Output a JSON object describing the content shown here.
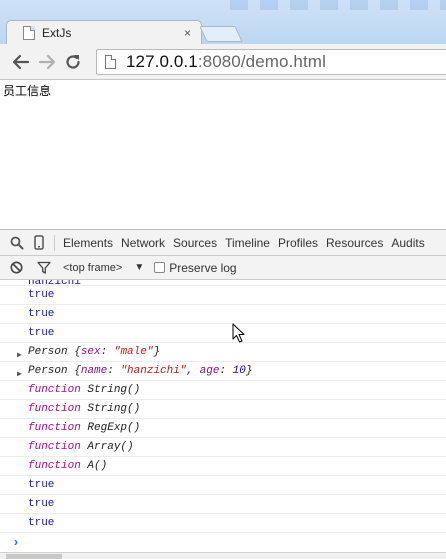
{
  "browser": {
    "tab_title": "ExtJs",
    "tab_close_glyph": "×",
    "url_host": "127.0.0.1",
    "url_rest": ":8080/demo.html"
  },
  "page": {
    "heading": "员工信息"
  },
  "devtools": {
    "tabs": [
      "Elements",
      "Network",
      "Sources",
      "Timeline",
      "Profiles",
      "Resources",
      "Audits"
    ],
    "frame_select": "<top frame>",
    "frame_arrow": "▼",
    "preserve_log": "Preserve log",
    "preserve_log_checked": false,
    "console": {
      "partial_line": "hanzichi",
      "bool_lines_1": [
        "true",
        "true",
        "true"
      ],
      "objects": [
        {
          "class_name": "Person",
          "open": "{",
          "props": [
            {
              "key": "sex",
              "sep": ": ",
              "value": "\"male\"",
              "kind": "str"
            }
          ],
          "close": "}"
        },
        {
          "class_name": "Person",
          "open": "{",
          "props": [
            {
              "key": "name",
              "sep": ": ",
              "value": "\"hanzichi\"",
              "kind": "str"
            },
            {
              "key": "age",
              "sep": ": ",
              "value": "10",
              "kind": "num"
            }
          ],
          "close": "}"
        }
      ],
      "functions": [
        {
          "keyword": "function",
          "name": "String()"
        },
        {
          "keyword": "function",
          "name": "String()"
        },
        {
          "keyword": "function",
          "name": "RegExp()"
        },
        {
          "keyword": "function",
          "name": "Array()"
        },
        {
          "keyword": "function",
          "name": "A()"
        }
      ],
      "bool_lines_2": [
        "true",
        "true",
        "true"
      ],
      "prompt": "›"
    }
  },
  "colors": {
    "accent_blue": "#1a1aa6",
    "keyword_purple": "#aa0d91",
    "string_red": "#c41a16",
    "prompt_blue": "#2a6df4"
  },
  "icons": {
    "back": "back-arrow-icon",
    "forward": "forward-arrow-icon",
    "reload": "reload-icon",
    "inspect": "inspect-element-icon",
    "device": "device-mode-icon",
    "clear": "clear-console-icon",
    "filter": "filter-icon"
  }
}
